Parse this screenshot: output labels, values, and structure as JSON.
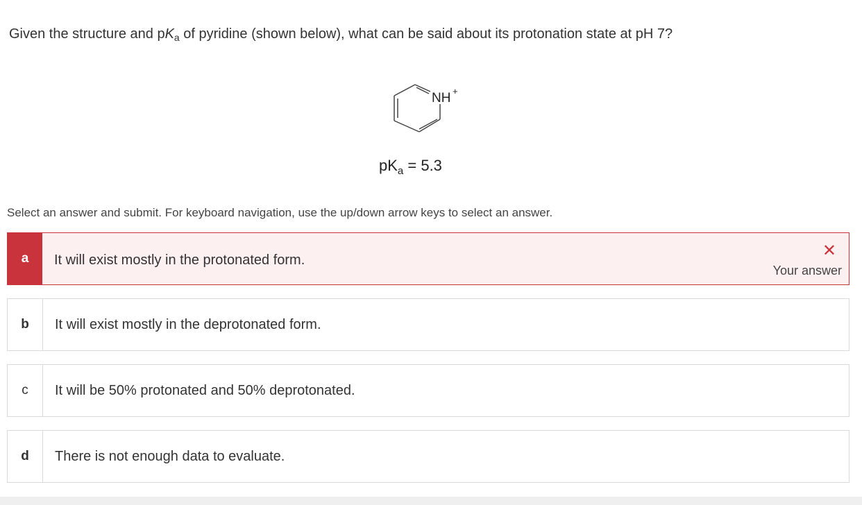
{
  "question": {
    "text_before": "Given the structure and p",
    "k_italic": "K",
    "subscript": "a",
    "text_after": " of pyridine (shown below), what can be said about its protonation state at pH 7?"
  },
  "structure": {
    "label": "NH",
    "charge": "+",
    "pka_prefix": "pK",
    "pka_sub": "a",
    "pka_suffix": " = 5.3"
  },
  "instructions": "Select an answer and submit. For keyboard navigation, use the up/down arrow keys to select an answer.",
  "answers": [
    {
      "letter": "a",
      "text": "It will exist mostly in the protonated form.",
      "state": "incorrect-selected"
    },
    {
      "letter": "b",
      "text": "It will exist mostly in the deprotonated form."
    },
    {
      "letter": "c",
      "text": "It will be 50% protonated and 50% deprotonated."
    },
    {
      "letter": "d",
      "text": "There is not enough data to evaluate."
    }
  ],
  "feedback": {
    "icon": "close-icon",
    "mark": "✕",
    "label": "Your answer"
  },
  "colors": {
    "incorrect": "#c9343c",
    "incorrect_bg": "#fdf0f1"
  }
}
